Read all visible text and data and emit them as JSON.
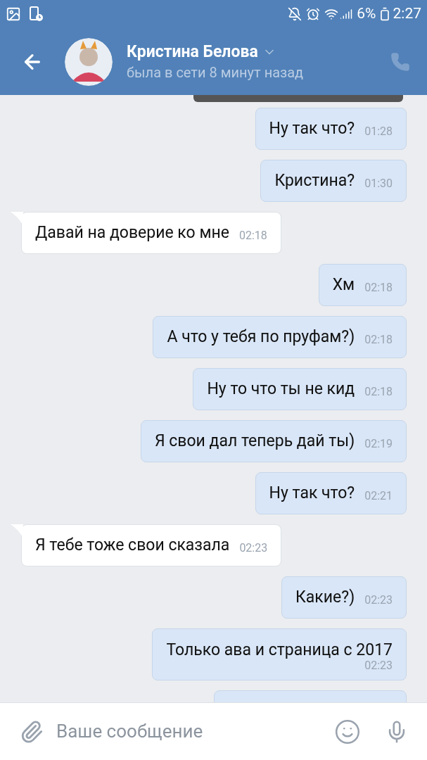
{
  "status_bar": {
    "battery": "6%",
    "time": "2:27"
  },
  "header": {
    "name": "Кристина Белова",
    "status": "была в сети 8 минут назад"
  },
  "messages": [
    {
      "outgoing": true,
      "kind": "inline",
      "text": "Ну так что?",
      "time": "01:28"
    },
    {
      "outgoing": true,
      "kind": "inline",
      "text": "Кристина?",
      "time": "01:30"
    },
    {
      "outgoing": false,
      "kind": "inline",
      "text": "Давай на доверие ко мне",
      "time": "02:18"
    },
    {
      "outgoing": true,
      "kind": "inline",
      "text": "Хм",
      "time": "02:18"
    },
    {
      "outgoing": true,
      "kind": "inline",
      "text": "А что у тебя по пруфам?)",
      "time": "02:18"
    },
    {
      "outgoing": true,
      "kind": "inline",
      "text": "Ну то что ты не кид",
      "time": "02:18"
    },
    {
      "outgoing": true,
      "kind": "inline",
      "text": "Я свои дал теперь дай ты)",
      "time": "02:19"
    },
    {
      "outgoing": true,
      "kind": "inline",
      "text": "Ну так что?",
      "time": "02:21"
    },
    {
      "outgoing": false,
      "kind": "inline",
      "text": "Я тебе тоже свои сказала",
      "time": "02:23"
    },
    {
      "outgoing": true,
      "kind": "inline",
      "text": "Какие?)",
      "time": "02:23"
    },
    {
      "outgoing": true,
      "kind": "stacked",
      "text": "Только ава и страница с 2017",
      "time": "02:23"
    },
    {
      "outgoing": true,
      "kind": "cut"
    }
  ],
  "composer": {
    "placeholder": "Ваше сообщение"
  }
}
